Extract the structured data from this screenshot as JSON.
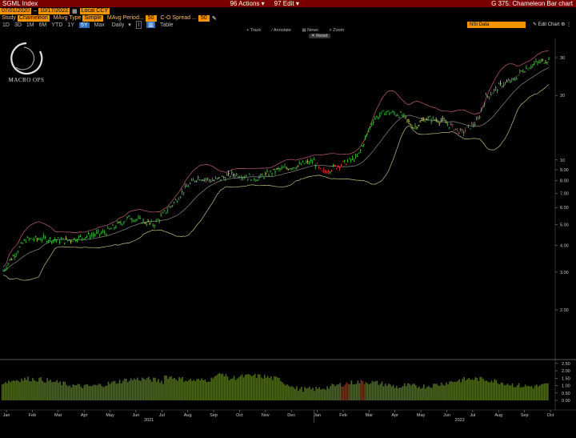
{
  "title_bar": {
    "ticker": "SGML Index",
    "hidden_field": "Edit Chart",
    "actions": "Actions",
    "actions_num": "96",
    "edit": "Edit",
    "edit_num": "97",
    "chart_name": "G 375: Chameleon Bar chart"
  },
  "dates": {
    "start": "07/01/2020",
    "end": "10/17/2022",
    "ccy": "Local CCY",
    "icon": "calendar-icon"
  },
  "study": {
    "label": "Study",
    "value": "Chameleon",
    "mavg_type_label": "MAvg Type",
    "mavg_type": "Simple",
    "mavg_period_label": "MAvg Period...",
    "mavg_period": "50",
    "spread_label": "C-O Spread ...",
    "spread": "50"
  },
  "ranges": {
    "items": [
      "1D",
      "3D",
      "1M",
      "6M",
      "YTD",
      "1Y",
      "5Y",
      "Max"
    ],
    "selected": "5Y",
    "freq": "Daily",
    "table": "Table"
  },
  "nsi": "NSI Data",
  "edit_chart": "Edit Chart",
  "mini_toolbar": [
    "Track",
    "Annotate",
    "News",
    "Zoom"
  ],
  "reset": "Reset",
  "logo_text": "MACRO OPS",
  "y_ticks": [
    "30",
    "20",
    "10",
    "9.00",
    "8.00",
    "7.00",
    "6.00",
    "5.00",
    "4.00",
    "3.00",
    "2.00"
  ],
  "y_values": [
    30,
    20,
    10,
    9,
    8,
    7,
    6,
    5,
    4,
    3,
    2
  ],
  "lower_ticks": [
    "2.50",
    "2.00",
    "1.50",
    "1.00",
    "0.50",
    "0.00"
  ],
  "lower_values": [
    2.5,
    2.0,
    1.5,
    1.0,
    0.5,
    0.0
  ],
  "x_months": [
    "Jan",
    "Feb",
    "Mar",
    "Apr",
    "May",
    "Jun",
    "Jul",
    "Aug",
    "Sep",
    "Oct",
    "Nov",
    "Dec",
    "Jan",
    "Feb",
    "Mar",
    "Apr",
    "May",
    "Jun",
    "Jul",
    "Aug",
    "Sep",
    "Oct"
  ],
  "x_years": [
    "2021",
    "2022"
  ],
  "colors": {
    "up": "#3ecb3e",
    "down": "#e33",
    "neutral": "#e4e45a",
    "band": "#c0c080",
    "band_upper": "#c06070",
    "mavg": "#8a8a8a",
    "vol": "#4e6b1d",
    "vol_red": "#8a2d0d"
  }
}
